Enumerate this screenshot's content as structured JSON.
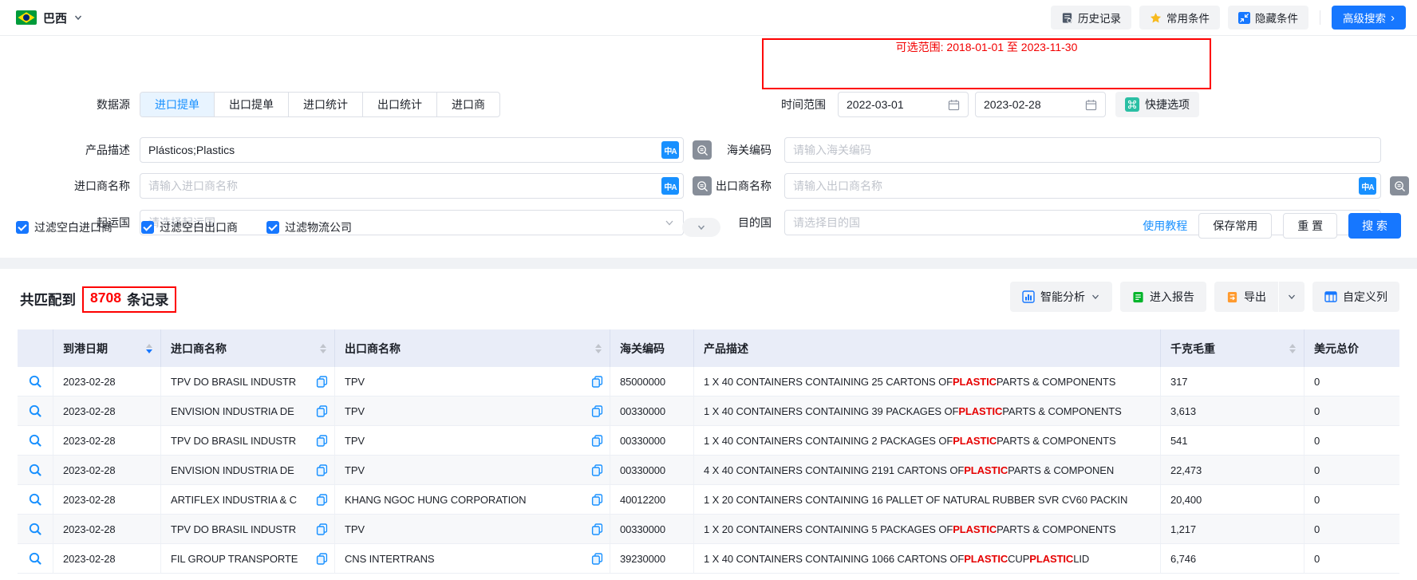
{
  "topbar": {
    "country": "巴西",
    "history": "历史记录",
    "favorites": "常用条件",
    "hide": "隐藏条件",
    "advanced": "高级搜索",
    "advanced_arrow": "›"
  },
  "filters": {
    "datasource_label": "数据源",
    "tabs": [
      {
        "label": "进口提单",
        "active": true
      },
      {
        "label": "出口提单",
        "active": false
      },
      {
        "label": "进口统计",
        "active": false
      },
      {
        "label": "出口统计",
        "active": false
      },
      {
        "label": "进口商",
        "active": false
      }
    ],
    "time_range": {
      "available_hint": "可选范围: 2018-01-01 至 2023-11-30",
      "label": "时间范围",
      "start_date": "2022-03-01",
      "end_date": "2023-02-28",
      "quick_options": "快捷选项"
    },
    "product_desc": {
      "label": "产品描述",
      "value": "Plásticos;Plastics"
    },
    "hs_code": {
      "label": "海关编码",
      "placeholder": "请输入海关编码"
    },
    "importer": {
      "label": "进口商名称",
      "placeholder": "请输入进口商名称"
    },
    "exporter": {
      "label": "出口商名称",
      "placeholder": "请输入出口商名称"
    },
    "origin_country": {
      "label": "起运国",
      "placeholder": "请选择起运国"
    },
    "dest_country": {
      "label": "目的国",
      "placeholder": "请选择目的国"
    },
    "checkboxes": [
      {
        "label": "过滤空白进口商",
        "checked": true
      },
      {
        "label": "过滤空白出口商",
        "checked": true
      },
      {
        "label": "过滤物流公司",
        "checked": true
      }
    ],
    "actions": {
      "tutorial": "使用教程",
      "save": "保存常用",
      "reset": "重 置",
      "search": "搜 索"
    }
  },
  "results": {
    "count_prefix": "共匹配到",
    "count": "8708",
    "count_suffix": "条记录",
    "toolbar": {
      "analysis": "智能分析",
      "report": "进入报告",
      "export": "导出",
      "customize": "自定义列"
    }
  },
  "table": {
    "highlight_keyword": "PLASTIC",
    "headers": [
      {
        "label": "",
        "sortable": false
      },
      {
        "label": "到港日期",
        "sortable": true,
        "sorted": "desc"
      },
      {
        "label": "进口商名称",
        "sortable": true
      },
      {
        "label": "出口商名称",
        "sortable": true
      },
      {
        "label": "海关编码",
        "sortable": false
      },
      {
        "label": "产品描述",
        "sortable": false
      },
      {
        "label": "千克毛重",
        "sortable": true
      },
      {
        "label": "美元总价",
        "sortable": false
      }
    ],
    "rows": [
      {
        "date": "2023-02-28",
        "importer": "TPV DO BRASIL INDUSTR",
        "exporter": "TPV",
        "hs_code": "85000000",
        "product": "1 X 40 CONTAINERS CONTAINING 25 CARTONS OF PLASTIC PARTS & COMPONENTS",
        "weight": "317",
        "usd": "0"
      },
      {
        "date": "2023-02-28",
        "importer": "ENVISION INDUSTRIA DE",
        "exporter": "TPV",
        "hs_code": "00330000",
        "product": "1 X 40 CONTAINERS CONTAINING 39 PACKAGES OF PLASTIC PARTS & COMPONENTS",
        "weight": "3,613",
        "usd": "0"
      },
      {
        "date": "2023-02-28",
        "importer": "TPV DO BRASIL INDUSTR",
        "exporter": "TPV",
        "hs_code": "00330000",
        "product": "1 X 40 CONTAINERS CONTAINING 2 PACKAGES OF PLASTIC PARTS & COMPONENTS",
        "weight": "541",
        "usd": "0"
      },
      {
        "date": "2023-02-28",
        "importer": "ENVISION INDUSTRIA DE",
        "exporter": "TPV",
        "hs_code": "00330000",
        "product": "4 X 40 CONTAINERS CONTAINING 2191 CARTONS OF PLASTIC PARTS & COMPONEN",
        "weight": "22,473",
        "usd": "0"
      },
      {
        "date": "2023-02-28",
        "importer": "ARTIFLEX INDUSTRIA & C",
        "exporter": "KHANG NGOC HUNG CORPORATION",
        "hs_code": "40012200",
        "product": "1 X 20 CONTAINERS CONTAINING 16 PALLET OF NATURAL RUBBER SVR CV60 PACKIN",
        "weight": "20,400",
        "usd": "0"
      },
      {
        "date": "2023-02-28",
        "importer": "TPV DO BRASIL INDUSTR",
        "exporter": "TPV",
        "hs_code": "00330000",
        "product": "1 X 20 CONTAINERS CONTAINING 5 PACKAGES OF PLASTIC PARTS & COMPONENTS",
        "weight": "1,217",
        "usd": "0"
      },
      {
        "date": "2023-02-28",
        "importer": "FIL GROUP TRANSPORTE",
        "exporter": "CNS INTERTRANS",
        "hs_code": "39230000",
        "product": "1 X 40 CONTAINERS CONTAINING 1066 CARTONS OF PLASTIC CUP PLASTIC LID",
        "weight": "6,746",
        "usd": "0"
      }
    ]
  }
}
